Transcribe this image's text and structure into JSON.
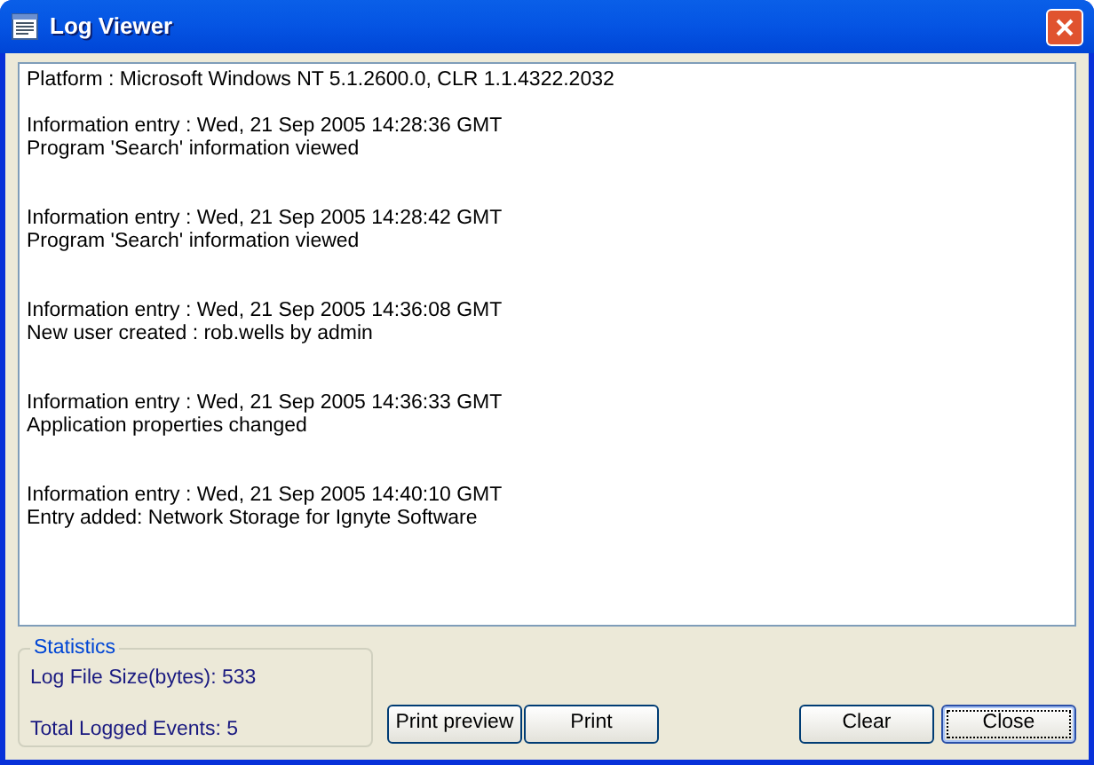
{
  "window": {
    "title": "Log Viewer"
  },
  "log": {
    "header": "Platform : Microsoft Windows NT 5.1.2600.0, CLR 1.1.4322.2032",
    "entries": [
      {
        "heading": "Information entry : Wed, 21 Sep 2005 14:28:36 GMT",
        "message": "Program 'Search' information viewed"
      },
      {
        "heading": "Information entry : Wed, 21 Sep 2005 14:28:42 GMT",
        "message": "Program 'Search' information viewed"
      },
      {
        "heading": "Information entry : Wed, 21 Sep 2005 14:36:08 GMT",
        "message": "New user created : rob.wells by admin"
      },
      {
        "heading": "Information entry : Wed, 21 Sep 2005 14:36:33 GMT",
        "message": "Application properties changed"
      },
      {
        "heading": "Information entry : Wed, 21 Sep 2005 14:40:10 GMT",
        "message": "Entry added: Network Storage for Ignyte Software"
      }
    ]
  },
  "statistics": {
    "title": "Statistics",
    "items": [
      "Log File Size(bytes): 533",
      "Total Logged Events: 5"
    ]
  },
  "buttons": [
    {
      "label": "Print preview",
      "focused": false
    },
    {
      "label": "Print",
      "focused": false
    },
    {
      "label": "Clear",
      "focused": false
    },
    {
      "label": "Close",
      "focused": true
    }
  ]
}
